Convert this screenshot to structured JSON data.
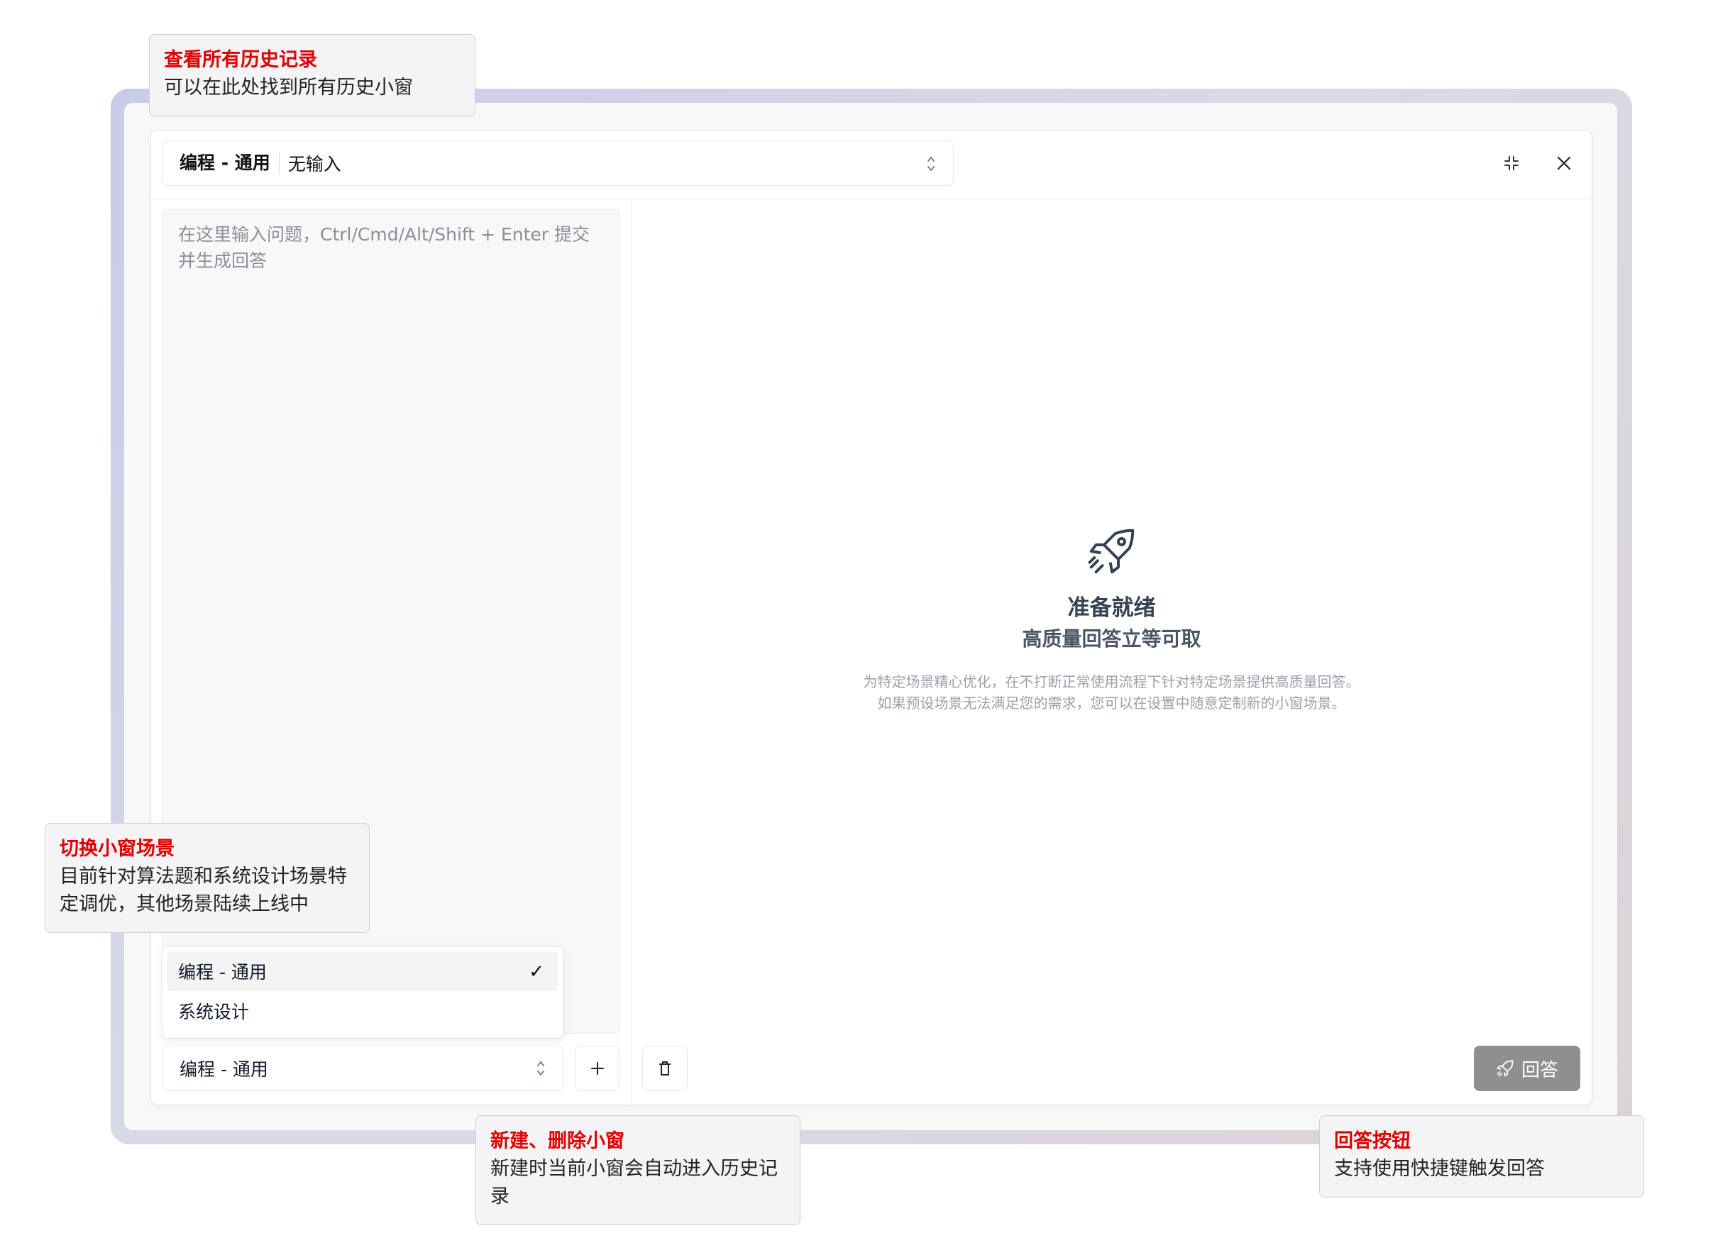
{
  "topbar": {
    "scene_name": "编程 - 通用",
    "scene_input": "无输入",
    "collapse_icon": "collapse-arrows-icon",
    "close_icon": "close-icon"
  },
  "editor": {
    "placeholder": "在这里输入问题，Ctrl/Cmd/Alt/Shift + Enter 提交并生成回答"
  },
  "scene_dropdown": {
    "options": [
      {
        "label": "编程 - 通用",
        "selected": true
      },
      {
        "label": "系统设计",
        "selected": false
      }
    ]
  },
  "bottom": {
    "scene_select_value": "编程 - 通用",
    "add_icon": "plus-icon",
    "delete_icon": "trash-icon",
    "answer_label": "回答"
  },
  "empty_state": {
    "icon": "rocket-icon",
    "title": "准备就绪",
    "subtitle": "高质量回答立等可取",
    "desc_line1": "为特定场景精心优化，在不打断正常使用流程下针对特定场景提供高质量回答。",
    "desc_line2": "如果预设场景无法满足您的需求，您可以在设置中随意定制新的小窗场景。"
  },
  "callouts": {
    "history": {
      "title": "查看所有历史记录",
      "desc": "可以在此处找到所有历史小窗"
    },
    "scene": {
      "title": "切换小窗场景",
      "desc": "目前针对算法题和系统设计场景特定调优，其他场景陆续上线中"
    },
    "new_delete": {
      "title": "新建、删除小窗",
      "desc": "新建时当前小窗会自动进入历史记录"
    },
    "answer": {
      "title": "回答按钮",
      "desc": "支持使用快捷键触发回答"
    }
  },
  "colors": {
    "callout_title": "#e00000",
    "answer_button": "#8f8f8f",
    "frame_gradient_start": "#c7cbe6"
  }
}
